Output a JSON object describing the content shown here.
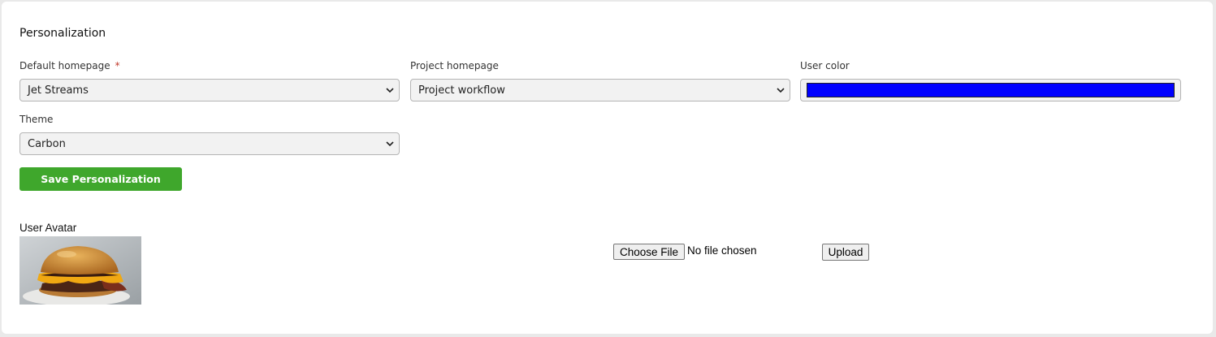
{
  "section": {
    "title": "Personalization"
  },
  "fields": {
    "default_homepage": {
      "label": "Default homepage",
      "required_mark": "*",
      "value": "Jet Streams"
    },
    "project_homepage": {
      "label": "Project homepage",
      "value": "Project workflow"
    },
    "user_color": {
      "label": "User color",
      "value": "#0000ff"
    },
    "theme": {
      "label": "Theme",
      "value": "Carbon"
    }
  },
  "save_button": {
    "label": "Save Personalization"
  },
  "avatar": {
    "label": "User Avatar",
    "choose_file_label": "Choose File",
    "file_status": "No file chosen",
    "upload_label": "Upload"
  },
  "colors": {
    "save_button": "#3fa72c",
    "user_color": "#0000ff"
  },
  "icons": {
    "select_arrow": "chevron-down-icon"
  }
}
